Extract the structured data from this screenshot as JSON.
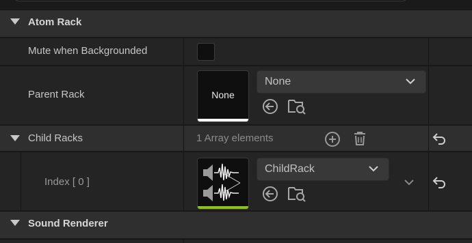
{
  "categories": {
    "atom_rack": "Atom Rack",
    "sound_renderer": "Sound Renderer"
  },
  "mute_when_backgrounded": {
    "label": "Mute when Backgrounded",
    "checked": false
  },
  "parent_rack": {
    "label": "Parent Rack",
    "thumbnail_text": "None",
    "value": "None"
  },
  "child_racks": {
    "label": "Child Racks",
    "count_text": "1 Array elements",
    "elements": [
      {
        "index_label": "Index [ 0 ]",
        "value": "ChildRack"
      }
    ]
  },
  "colors": {
    "asset_bar_none": "#ffffff",
    "asset_bar_rack": "#8cc21f"
  },
  "icons": [
    "expand-triangle-icon",
    "chevron-down-icon",
    "use-selected-icon",
    "browse-asset-icon",
    "add-element-icon",
    "delete-all-icon",
    "reset-to-default-icon",
    "sound-waveform-icon"
  ]
}
